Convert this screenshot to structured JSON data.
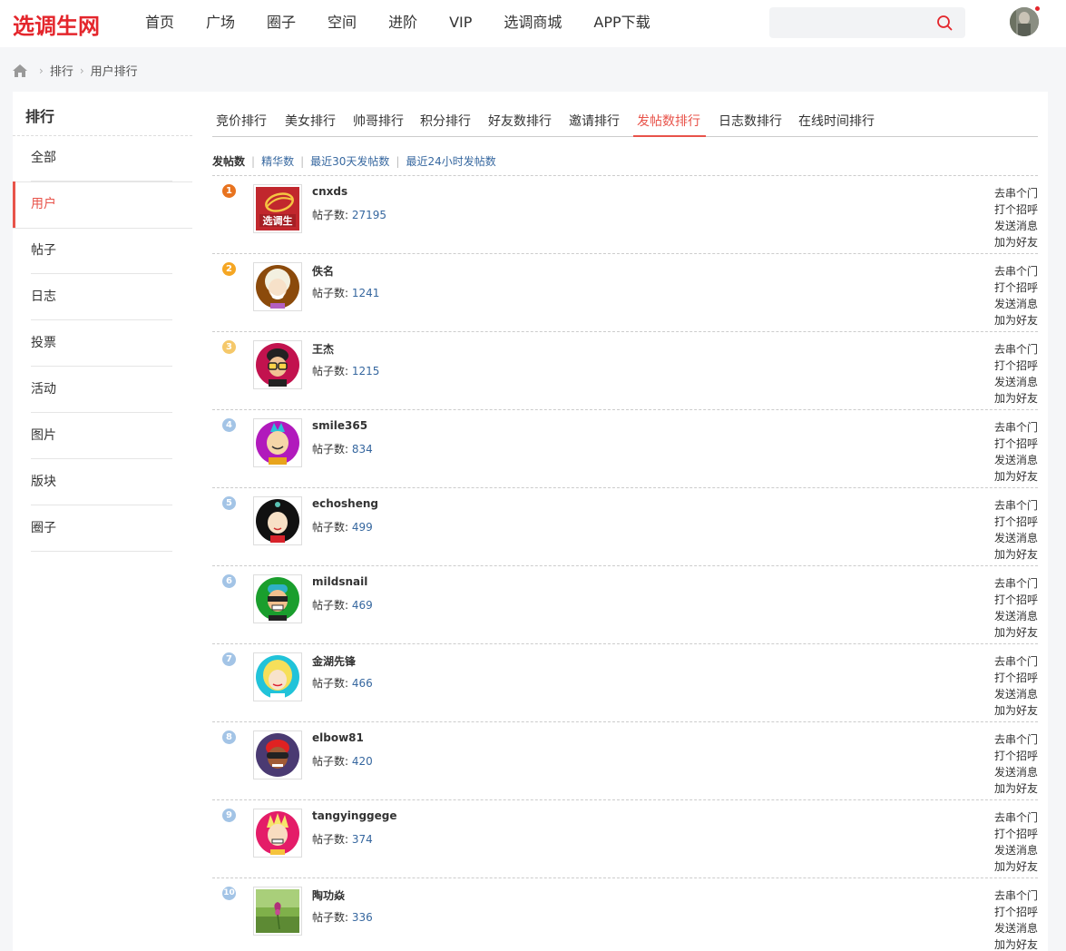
{
  "header": {
    "logo": "选调生网",
    "nav": [
      "首页",
      "广场",
      "圈子",
      "空间",
      "进阶",
      "VIP",
      "选调商城",
      "APP下载"
    ],
    "search_placeholder": ""
  },
  "breadcrumb": [
    "排行",
    "用户排行"
  ],
  "sidebar": {
    "title": "排行",
    "items": [
      "全部",
      "用户",
      "帖子",
      "日志",
      "投票",
      "活动",
      "图片",
      "版块",
      "圈子"
    ],
    "active_index": 1
  },
  "tabs": [
    "竞价排行",
    "美女排行",
    "帅哥排行",
    "积分排行",
    "好友数排行",
    "邀请排行",
    "发帖数排行",
    "日志数排行",
    "在线时间排行"
  ],
  "active_tab": "发帖数排行",
  "subtabs": [
    "发帖数",
    "精华数",
    "最近30天发帖数",
    "最近24小时发帖数"
  ],
  "post_label": "帖子数:",
  "actions": [
    "去串个门",
    "打个招呼",
    "发送消息",
    "加为好友"
  ],
  "colors": {
    "accent": "#e8534a",
    "brand": "#e4262c",
    "link": "#36679f",
    "rank1": "#e8731f",
    "rank2": "#f5a623",
    "rank3": "#f5c86a",
    "rank_other": "#a3c4e6"
  },
  "users": [
    {
      "rank": "1",
      "name": "cnxds",
      "posts": "27195",
      "avatar": "logo-avatar"
    },
    {
      "rank": "2",
      "name": "佚名",
      "posts": "1241",
      "avatar": "white-hair-avatar"
    },
    {
      "rank": "3",
      "name": "王杰",
      "posts": "1215",
      "avatar": "glasses-avatar"
    },
    {
      "rank": "4",
      "name": "smile365",
      "posts": "834",
      "avatar": "mohawk-avatar"
    },
    {
      "rank": "5",
      "name": "echosheng",
      "posts": "499",
      "avatar": "dark-hair-avatar"
    },
    {
      "rank": "6",
      "name": "mildsnail",
      "posts": "469",
      "avatar": "sunglasses-avatar"
    },
    {
      "rank": "7",
      "name": "金湖先锋",
      "posts": "466",
      "avatar": "blonde-avatar"
    },
    {
      "rank": "8",
      "name": "elbow81",
      "posts": "420",
      "avatar": "visor-avatar"
    },
    {
      "rank": "9",
      "name": "tangyinggege",
      "posts": "374",
      "avatar": "spiky-hair-avatar"
    },
    {
      "rank": "10",
      "name": "陶功焱",
      "posts": "336",
      "avatar": "flower-photo-avatar"
    }
  ]
}
